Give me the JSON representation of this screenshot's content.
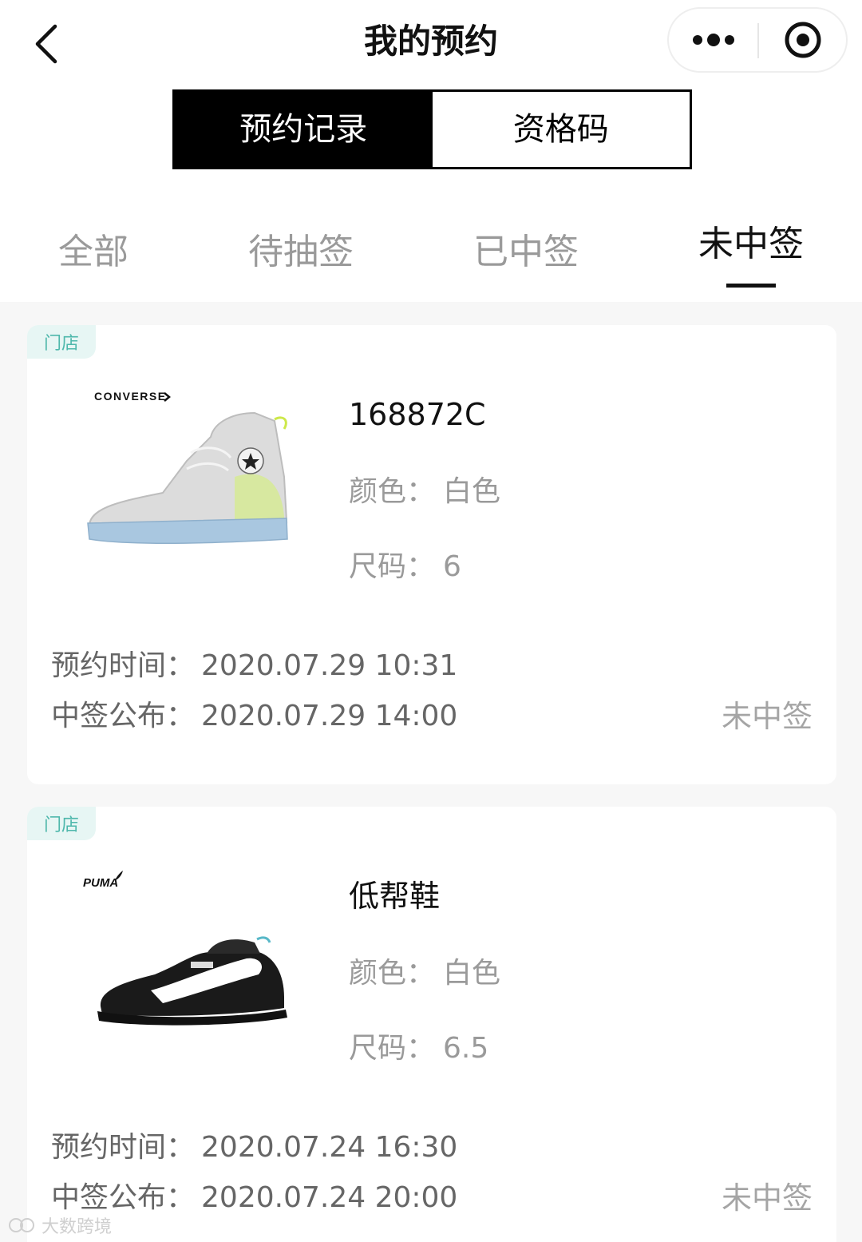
{
  "nav": {
    "title": "我的预约",
    "back_icon": "chevron-left-icon",
    "more_icon": "more-dots-icon",
    "close_icon": "target-circle-icon"
  },
  "segments": [
    {
      "label": "预约记录",
      "active": true
    },
    {
      "label": "资格码",
      "active": false
    }
  ],
  "tabs": [
    {
      "label": "全部",
      "active": false
    },
    {
      "label": "待抽签",
      "active": false
    },
    {
      "label": "已中签",
      "active": false
    },
    {
      "label": "未中签",
      "active": true
    }
  ],
  "reservations": [
    {
      "badge": "门店",
      "brand_logo": "CONVERSE",
      "product_name": "168872C",
      "color_label": "颜色：",
      "color_value": "白色",
      "size_label": "尺码：",
      "size_value": "6",
      "reserve_label": "预约时间：",
      "reserve_time": "2020.07.29 10:31",
      "announce_label": "中签公布：",
      "announce_time": "2020.07.29 14:00",
      "result": "未中签"
    },
    {
      "badge": "门店",
      "brand_logo": "PUMA",
      "product_name": "低帮鞋",
      "color_label": "颜色：",
      "color_value": "白色",
      "size_label": "尺码：",
      "size_value": "6.5",
      "reserve_label": "预约时间：",
      "reserve_time": "2020.07.24 16:30",
      "announce_label": "中签公布：",
      "announce_time": "2020.07.24 20:00",
      "result": "未中签"
    }
  ],
  "watermark": "大数跨境",
  "colors": {
    "badge_bg": "#e7f6f4",
    "badge_text": "#4fb8ac",
    "active": "#000000",
    "inactive_tab": "#9a9a9a"
  }
}
